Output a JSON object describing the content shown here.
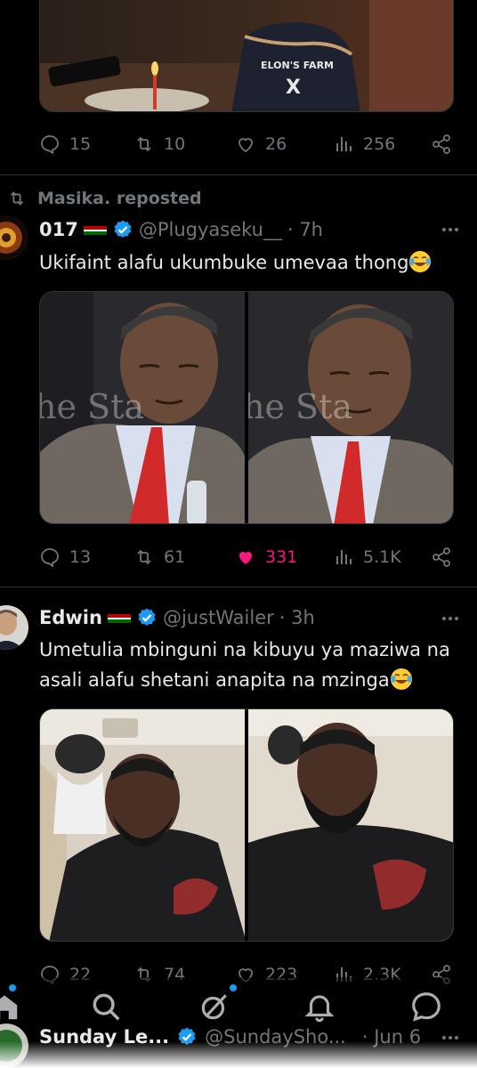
{
  "colors": {
    "background": "#000000",
    "text": "#e7e9ea",
    "muted": "#71767b",
    "like_active": "#f91880",
    "verified": "#1d9bf0",
    "separator": "#2f3336"
  },
  "post0": {
    "media_shirt_line1": "ELON'S FARM",
    "media_shirt_line2": "X",
    "actions": {
      "replies": "15",
      "reposts": "10",
      "likes": "26",
      "views": "256"
    }
  },
  "post1": {
    "repost_label": "Masika. reposted",
    "name": "017",
    "handle": "@Plugyaseku__",
    "time": "· 7h",
    "text": "Ukifaint alafu ukumbuke umevaa thong",
    "emoji": "face-with-tears-of-joy",
    "watermark_left": "he Sta",
    "watermark_right": "he Sta",
    "actions": {
      "replies": "13",
      "reposts": "61",
      "likes": "331",
      "views": "5.1K"
    },
    "liked": true
  },
  "post2": {
    "name": "Edwin",
    "handle": "@justWailer",
    "time": "· 3h",
    "text": "Umetulia mbinguni na kibuyu ya maziwa na asali alafu shetani anapita na mzinga",
    "emoji": "face-with-tears-of-joy",
    "actions": {
      "replies": "22",
      "reposts": "74",
      "likes": "223",
      "views": "2.3K"
    }
  },
  "post3": {
    "name": "Sunday Le...",
    "handle": "@SundaySho...",
    "time": "· Jun 6"
  },
  "icons": [
    "reply-icon",
    "repost-icon",
    "like-icon",
    "views-icon",
    "share-icon",
    "more-icon",
    "verified-icon",
    "home-icon",
    "search-icon",
    "grok-icon",
    "notifications-icon",
    "messages-icon"
  ]
}
